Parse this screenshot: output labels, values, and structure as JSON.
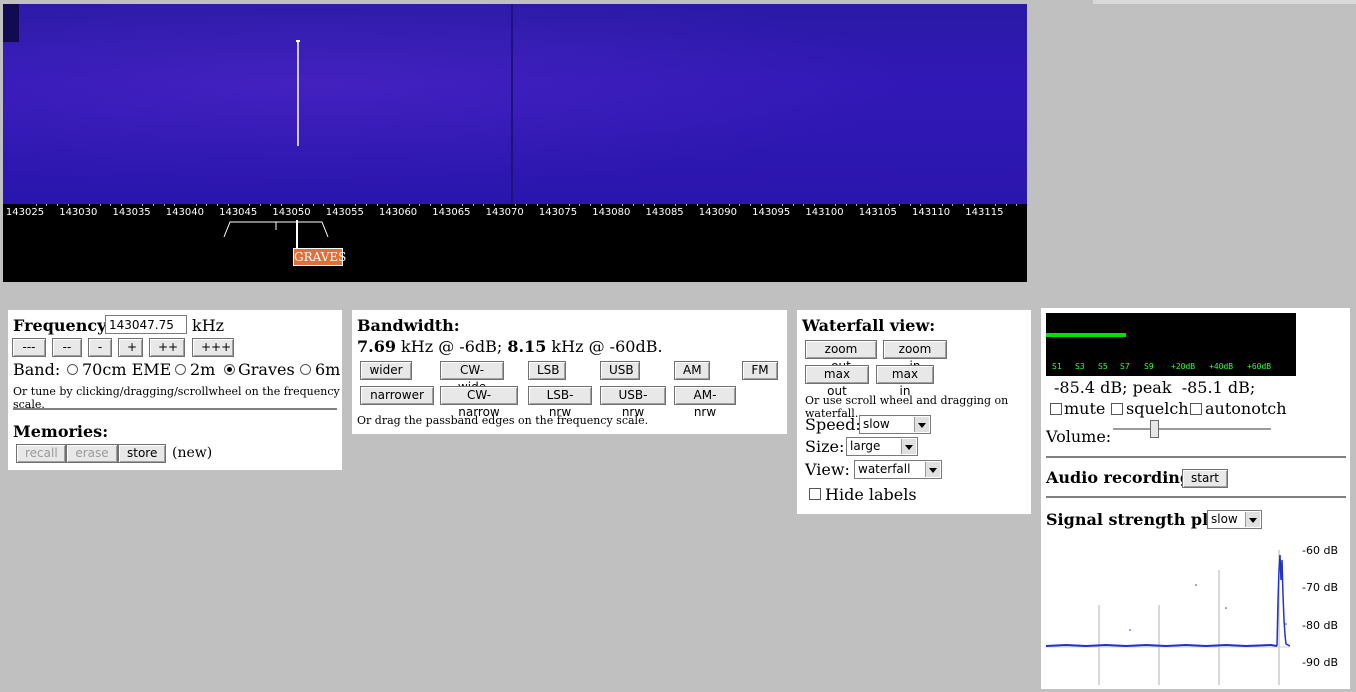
{
  "scale": {
    "tick_labels": [
      "143025",
      "143030",
      "143035",
      "143040",
      "143045",
      "143050",
      "143055",
      "143060",
      "143065",
      "143070",
      "143075",
      "143080",
      "143085",
      "143090",
      "143095",
      "143100",
      "143105",
      "143110",
      "143115"
    ],
    "marker_label": "GRAVES"
  },
  "frequency": {
    "label": "Frequency:",
    "value": "143047.75",
    "unit": "kHz",
    "step_buttons": [
      "---",
      "--",
      "-",
      "+",
      "++",
      "+++"
    ],
    "band_label": "Band:",
    "bands": [
      {
        "label": "70cm EME",
        "selected": false
      },
      {
        "label": "2m",
        "selected": false
      },
      {
        "label": "Graves",
        "selected": true
      },
      {
        "label": "6m",
        "selected": false
      }
    ],
    "hint": "Or tune by clicking/dragging/scrollwheel on the frequency scale."
  },
  "memories": {
    "label": "Memories:",
    "recall": "recall",
    "erase": "erase",
    "store": "store",
    "status": "(new)"
  },
  "bandwidth": {
    "label": "Bandwidth:",
    "bw6": "7.69",
    "bw6_text": " kHz @ -6dB; ",
    "bw60": "8.15",
    "bw60_text": " kHz @ -60dB.",
    "row1": [
      "wider",
      "CW-wide",
      "LSB",
      "USB",
      "AM",
      "FM"
    ],
    "row2": [
      "narrower",
      "CW-narrow",
      "LSB-nrw",
      "USB-nrw",
      "AM-nrw"
    ],
    "hint": "Or drag the passband edges on the frequency scale."
  },
  "waterfall": {
    "label": "Waterfall view:",
    "zoom_out": "zoom out",
    "zoom_in": "zoom in",
    "max_out": "max out",
    "max_in": "max in",
    "hint": "Or use scroll wheel and dragging on waterfall.",
    "speed_label": "Speed:",
    "speed_value": "slow",
    "size_label": "Size:",
    "size_value": "large",
    "view_label": "View:",
    "view_value": "waterfall",
    "hide_labels": "Hide labels"
  },
  "audio": {
    "s_labels": [
      "S1",
      "S3",
      "S5",
      "S7",
      "S9",
      "+20dB",
      "+40dB",
      "+60dB"
    ],
    "level_fraction": 0.32,
    "level_text": "-85.4 dB; peak  -85.1 dB;",
    "mute": "mute",
    "squelch": "squelch",
    "autonotch": "autonotch",
    "volume_label": "Volume:",
    "volume_fraction": 0.25,
    "recording_label": "Audio recording:",
    "recording_button": "start",
    "plot_label": "Signal strength plot:",
    "plot_speed": "slow",
    "db_labels": [
      "-60 dB",
      "-70 dB",
      "-80 dB",
      "-90 dB"
    ]
  },
  "colors": {
    "waterfall_bg": "#2a16ad",
    "marker": "#e0703a",
    "meter": "#00e000"
  }
}
